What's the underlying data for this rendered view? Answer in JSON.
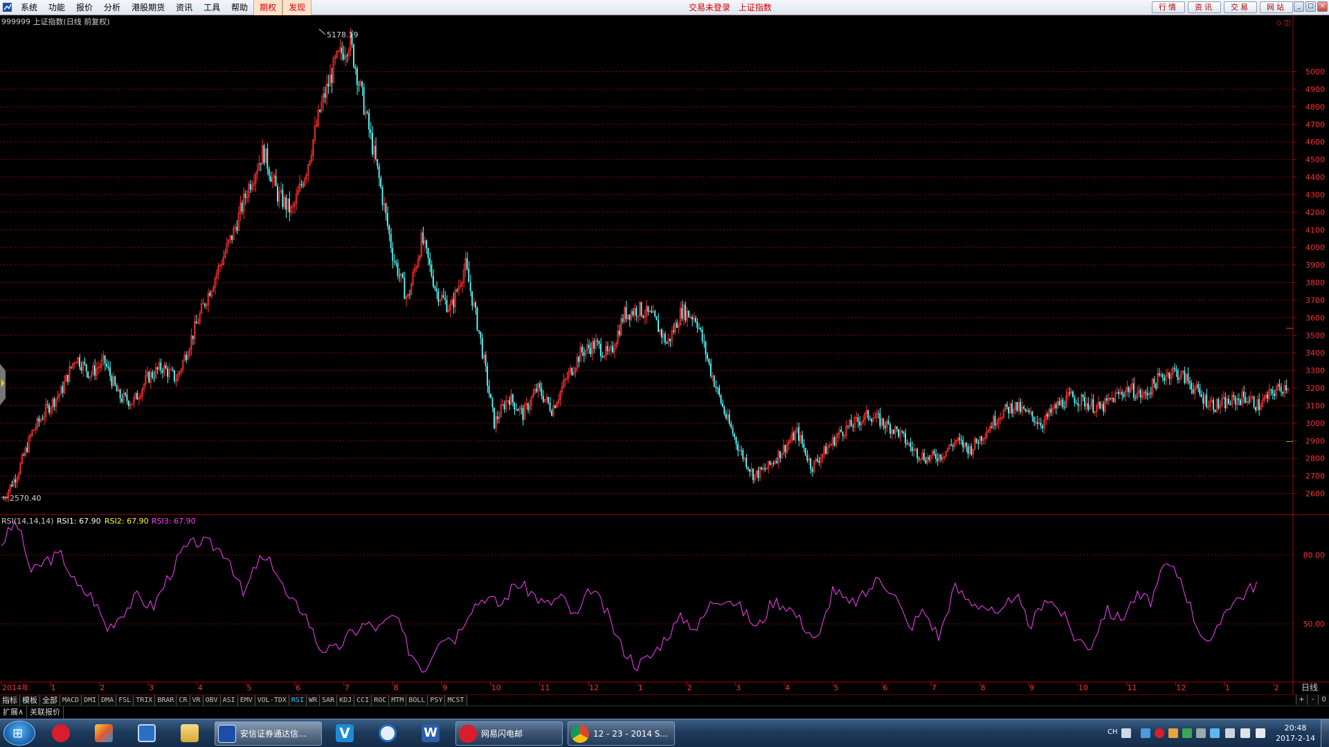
{
  "menubar": {
    "items": [
      "系统",
      "功能",
      "报价",
      "分析",
      "港股期货",
      "资讯",
      "工具",
      "帮助"
    ],
    "highlight_items": [
      "期权",
      "发现"
    ],
    "status": [
      "交易未登录",
      "上证指数"
    ],
    "buttons": [
      "行情",
      "资讯",
      "交易",
      "网站"
    ]
  },
  "chart_header": {
    "title": "999999 上证指数(日线 前复权)",
    "rsi_label": "RSI(14,14,14)",
    "rsi1": "RSI1: 67.90",
    "rsi2": "RSI2: 67.90",
    "rsi3": "RSI3: 67.90",
    "high_marker": "5178.19",
    "low_marker": "2570.40",
    "period_label": "日线"
  },
  "colors": {
    "up": "#ff3232",
    "down": "#54ffff",
    "rsi": "#ff40ff",
    "grid": "#8c0000",
    "axis_text": "#ff3232"
  },
  "chart_data": [
    {
      "type": "candlestick",
      "title": "999999 上证指数(日线 前复权)",
      "yticks": [
        2600,
        2700,
        2800,
        2900,
        3000,
        3100,
        3200,
        3300,
        3400,
        3500,
        3600,
        3700,
        3800,
        3900,
        4000,
        4100,
        4200,
        4300,
        4400,
        4500,
        4600,
        4700,
        4800,
        4900,
        5000
      ],
      "ylim": [
        2480,
        5250
      ],
      "xticks": [
        "2014年",
        "1",
        "2",
        "3",
        "4",
        "5",
        "6",
        "7",
        "8",
        "9",
        "10",
        "11",
        "12",
        "1",
        "2",
        "3",
        "4",
        "5",
        "6",
        "7",
        "8",
        "9",
        "10",
        "11",
        "12",
        "1",
        "2"
      ],
      "grid": true,
      "annotations": [
        "5178.19",
        "2570.40"
      ],
      "series": [
        {
          "name": "close (approx, sampled)",
          "values": [
            2570,
            2720,
            2950,
            3080,
            3180,
            3380,
            3280,
            3350,
            3150,
            3120,
            3260,
            3320,
            3250,
            3480,
            3700,
            3900,
            4100,
            4350,
            4550,
            4300,
            4200,
            4450,
            4800,
            5050,
            5178,
            4800,
            4400,
            3950,
            3700,
            4050,
            3750,
            3650,
            3900,
            3500,
            3000,
            3150,
            3050,
            3200,
            3080,
            3250,
            3400,
            3450,
            3380,
            3620,
            3650,
            3600,
            3450,
            3640,
            3600,
            3300,
            3050,
            2850,
            2700,
            2750,
            2850,
            2950,
            2750,
            2850,
            2950,
            3000,
            3050,
            3000,
            2950,
            2850,
            2800,
            2820,
            2900,
            2850,
            2950,
            3050,
            3100,
            3050,
            3000,
            3100,
            3150,
            3120,
            3080,
            3150,
            3200,
            3150,
            3250,
            3300,
            3250,
            3150,
            3100,
            3120,
            3150,
            3100,
            3180,
            3220
          ]
        }
      ]
    },
    {
      "type": "line",
      "title": "RSI(14,14,14)",
      "yticks": [
        50,
        80
      ],
      "ylim": [
        25,
        97
      ],
      "series": [
        {
          "name": "RSI1",
          "values": [
            85,
            95,
            72,
            78,
            80,
            66,
            62,
            48,
            55,
            62,
            57,
            70,
            82,
            86,
            84,
            80,
            62,
            78,
            76,
            60,
            56,
            40,
            38,
            45,
            50,
            48,
            54,
            38,
            30,
            45,
            44,
            57,
            62,
            58,
            68,
            64,
            58,
            62,
            52,
            66,
            55,
            40,
            32,
            36,
            45,
            53,
            48,
            60,
            62,
            56,
            48,
            60,
            58,
            50,
            42,
            66,
            58,
            62,
            70,
            64,
            48,
            56,
            44,
            66,
            60,
            58,
            52,
            64,
            48,
            62,
            56,
            44,
            40,
            56,
            52,
            62,
            60,
            76,
            70,
            50,
            40,
            58,
            62,
            68
          ]
        }
      ]
    }
  ],
  "indicator_tabs": [
    "指标",
    "模板",
    "全部",
    "MACD",
    "DMI",
    "DMA",
    "FSL",
    "TRIX",
    "BRAR",
    "CR",
    "VR",
    "OBV",
    "ASI",
    "EMV",
    "VOL-TDX",
    "RSI",
    "WR",
    "SAR",
    "KDJ",
    "CCI",
    "ROC",
    "MTM",
    "BOLL",
    "PSY",
    "MCST"
  ],
  "active_tab": "RSI",
  "tab_right": [
    "+",
    "-",
    "0"
  ],
  "sub_tabs": [
    "扩展∧",
    "关联报价"
  ],
  "taskbar": {
    "tasks": [
      "安信证券通达信...",
      "网易闪电邮",
      "12 - 23 - 2014 S..."
    ],
    "lang": "CH",
    "time": "20:48",
    "date": "2017-2-14"
  }
}
